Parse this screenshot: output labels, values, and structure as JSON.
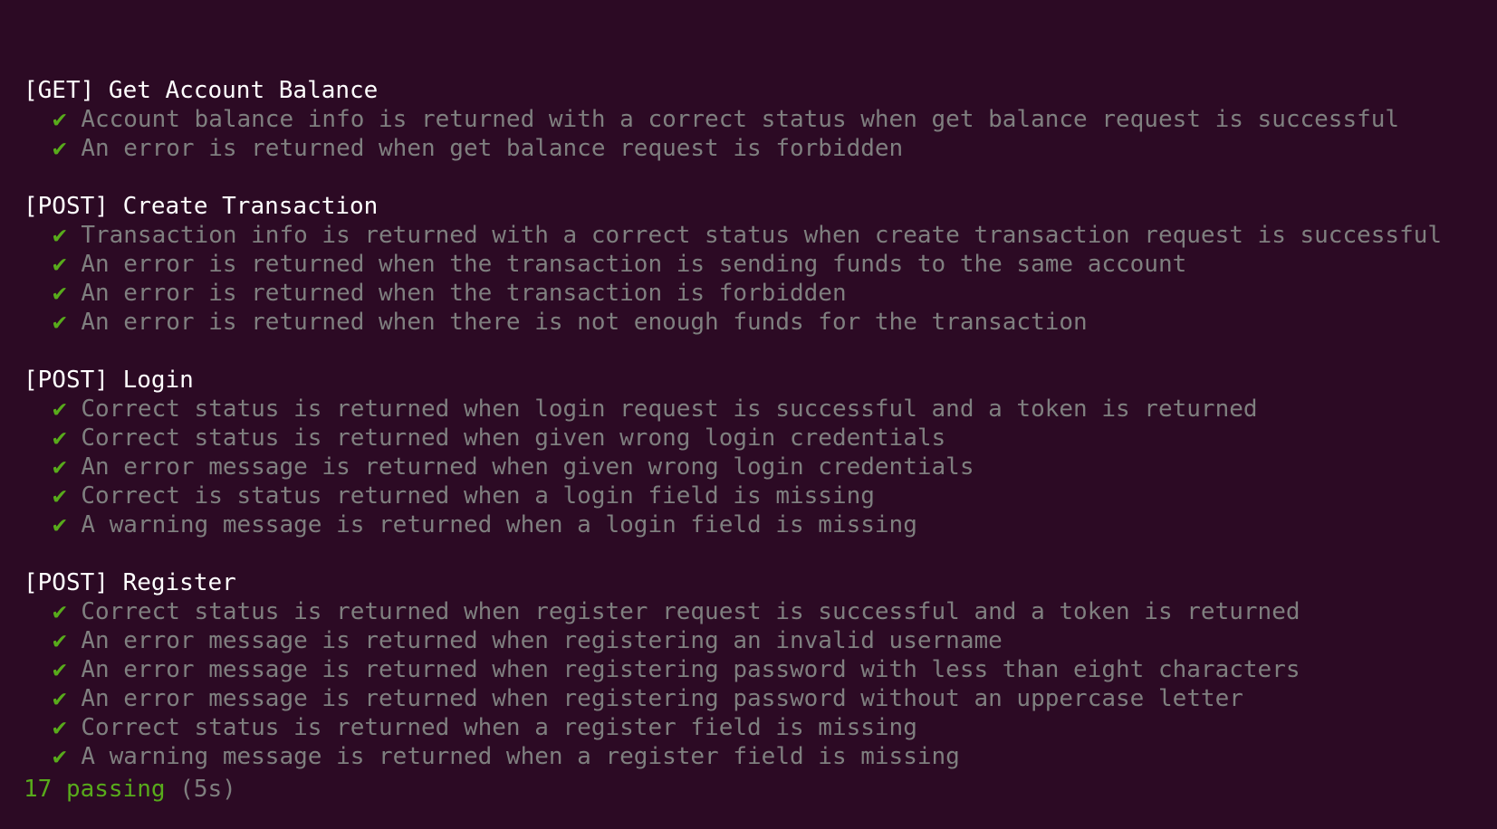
{
  "check_glyph": "✔",
  "colors": {
    "background": "#2c0a24",
    "title": "#ffffff",
    "pass_check": "#58ab1b",
    "test_text": "#7f7f7f"
  },
  "suites": [
    {
      "title": "[GET] Get Account Balance",
      "tests": [
        "Account balance info is returned with a correct status when get balance request is successful",
        "An error is returned when get balance request is forbidden"
      ]
    },
    {
      "title": "[POST] Create Transaction",
      "tests": [
        "Transaction info is returned with a correct status when create transaction request is successful",
        "An error is returned when the transaction is sending funds to the same account",
        "An error is returned when the transaction is forbidden",
        "An error is returned when there is not enough funds for the transaction"
      ]
    },
    {
      "title": "[POST] Login",
      "tests": [
        "Correct status is returned when login request is successful and a token is returned",
        "Correct status is returned when given wrong login credentials",
        "An error message is returned when given wrong login credentials",
        "Correct is status returned when a login field is missing",
        "A warning message is returned when a login field is missing"
      ]
    },
    {
      "title": "[POST] Register",
      "tests": [
        "Correct status is returned when register request is successful and a token is returned",
        "An error message is returned when registering an invalid username",
        "An error message is returned when registering password with less than eight characters",
        "An error message is returned when registering password without an uppercase letter",
        "Correct status is returned when a register field is missing",
        "A warning message is returned when a register field is missing"
      ]
    }
  ],
  "summary": {
    "passing": "17 passing",
    "duration": "(5s)"
  }
}
